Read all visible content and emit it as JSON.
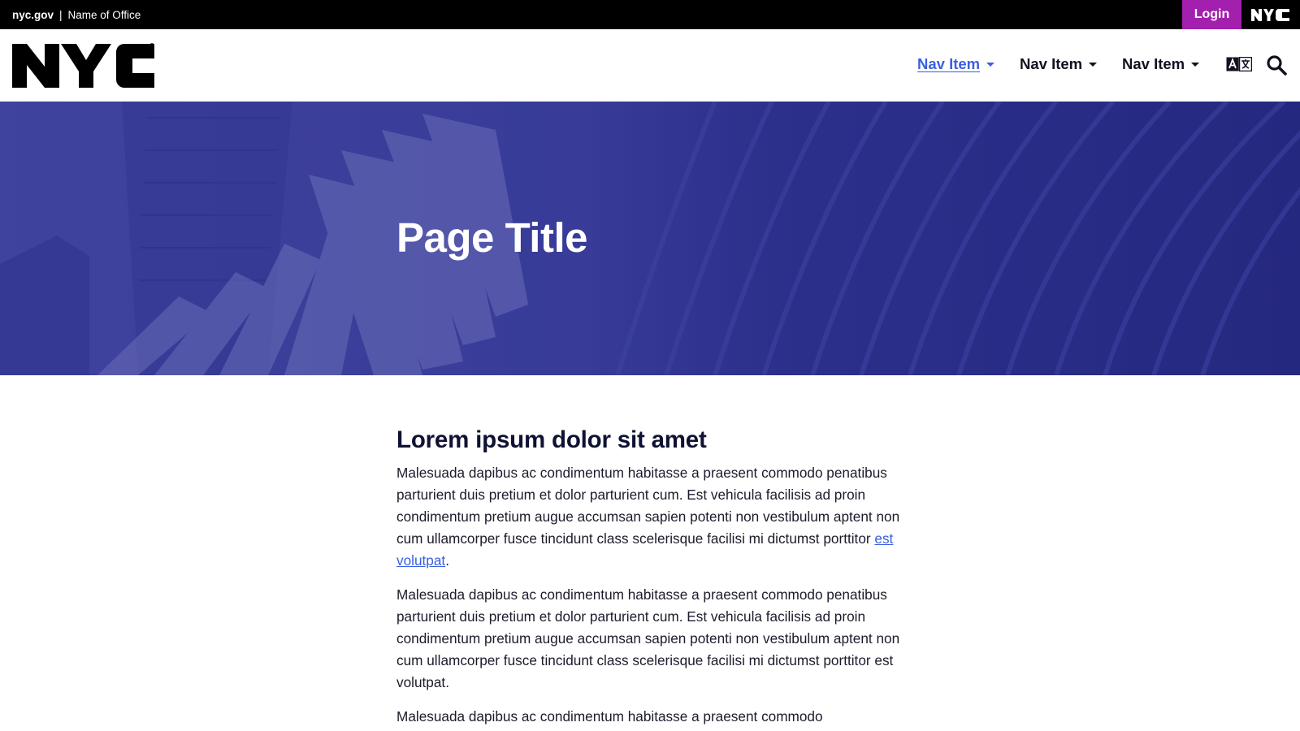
{
  "topbar": {
    "site": "nyc.gov",
    "separator": "|",
    "office": "Name of Office",
    "login_label": "Login",
    "brand_mark": "NYC"
  },
  "header": {
    "logo_text": "NYC",
    "nav": [
      {
        "label": "Nav Item",
        "active": true
      },
      {
        "label": "Nav Item",
        "active": false
      },
      {
        "label": "Nav Item",
        "active": false
      }
    ],
    "translate_icon": "translate-icon",
    "search_icon": "search-icon"
  },
  "hero": {
    "title": "Page Title",
    "overlay_color": "#2c2f8a"
  },
  "content": {
    "heading": "Lorem ipsum dolor sit amet",
    "paragraphs": [
      {
        "text": "Malesuada dapibus ac condimentum habitasse a praesent commodo penatibus parturient duis pretium et dolor parturient cum. Est vehicula facilisis ad proin condimentum pretium augue accumsan sapien potenti non vestibulum aptent non cum ullamcorper fusce tincidunt class scelerisque facilisi mi dictumst porttitor ",
        "link": "est volutpat",
        "after": "."
      },
      {
        "text": "Malesuada dapibus ac condimentum habitasse a praesent commodo penatibus parturient duis pretium et dolor parturient cum. Est vehicula facilisis ad proin condimentum pretium augue accumsan sapien potenti non vestibulum aptent non cum ullamcorper fusce tincidunt class scelerisque facilisi mi dictumst porttitor est volutpat."
      },
      {
        "text": "Malesuada dapibus ac condimentum habitasse a praesent commodo"
      }
    ]
  },
  "colors": {
    "accent": "#3a5fe0",
    "login": "#a31fae",
    "topbar": "#000000"
  }
}
